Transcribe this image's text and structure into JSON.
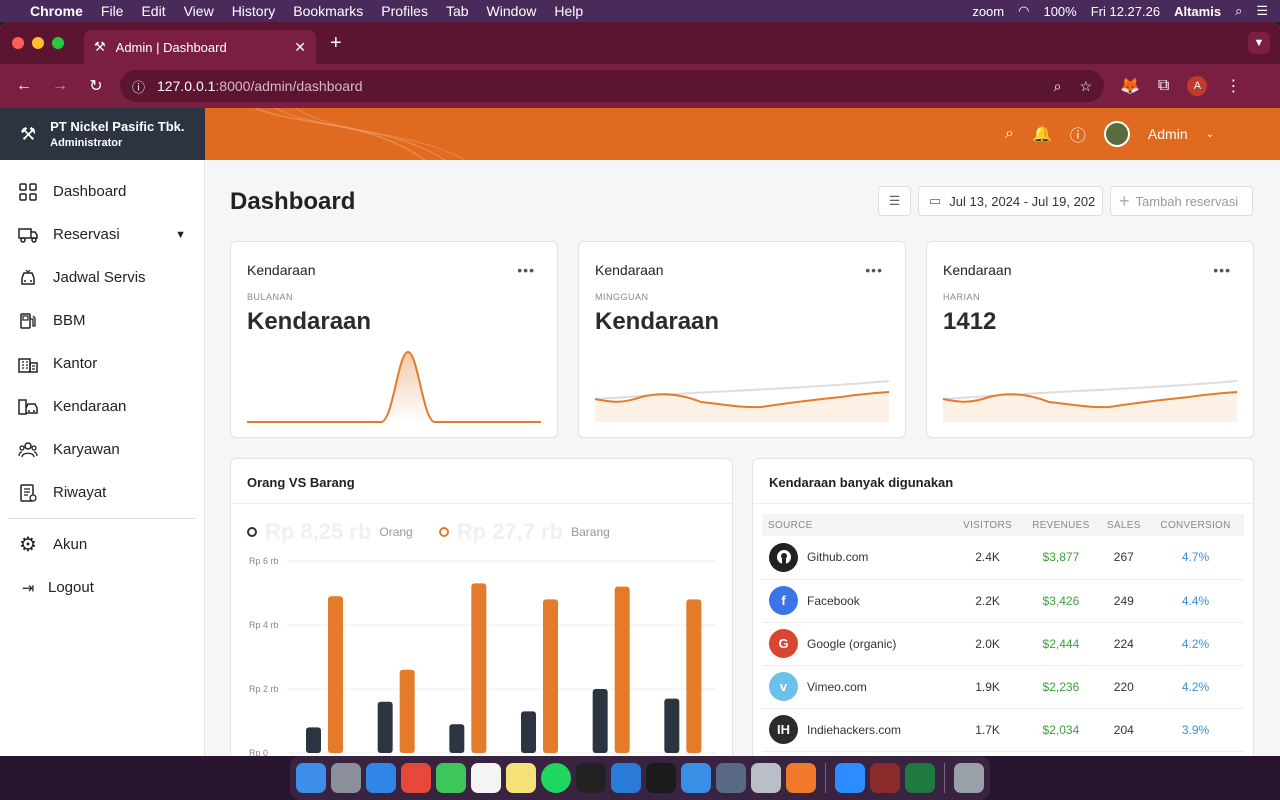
{
  "menubar": {
    "app": "Chrome",
    "items": [
      "File",
      "Edit",
      "View",
      "History",
      "Bookmarks",
      "Profiles",
      "Tab",
      "Window",
      "Help"
    ],
    "zoom": "zoom",
    "battery": "100%",
    "datetime": "Fri 12.27.26",
    "user": "Altamis"
  },
  "browser": {
    "tab_title": "Admin | Dashboard",
    "url_host": "127.0.0.1",
    "url_path": ":8000/admin/dashboard",
    "profile_initial": "A"
  },
  "brand": {
    "company": "PT Nickel Pasific Tbk.",
    "role": "Administrator"
  },
  "topbar": {
    "user_name": "Admin"
  },
  "sidebar": {
    "items": [
      {
        "label": "Dashboard",
        "icon": "grid-icon"
      },
      {
        "label": "Reservasi",
        "icon": "truck-icon"
      },
      {
        "label": "Jadwal Servis",
        "icon": "car-service-icon"
      },
      {
        "label": "BBM",
        "icon": "fuel-icon"
      },
      {
        "label": "Kantor",
        "icon": "building-icon"
      },
      {
        "label": "Kendaraan",
        "icon": "vehicle-icon"
      },
      {
        "label": "Karyawan",
        "icon": "people-icon"
      },
      {
        "label": "Riwayat",
        "icon": "history-icon"
      }
    ],
    "bottom": [
      {
        "label": "Akun",
        "icon": "gear-icon"
      },
      {
        "label": "Logout",
        "icon": "logout-icon"
      }
    ]
  },
  "page": {
    "title": "Dashboard",
    "date_range": "Jul 13, 2024 - Jul 19, 202",
    "add_button": "Tambah reservasi"
  },
  "stat_cards": [
    {
      "title": "Kendaraan",
      "period": "BULANAN",
      "value": "Kendaraan"
    },
    {
      "title": "Kendaraan",
      "period": "MINGGUAN",
      "value": "Kendaraan"
    },
    {
      "title": "Kendaraan",
      "period": "HARIAN",
      "value": "1412"
    }
  ],
  "chart_card": {
    "title": "Orang VS Barang",
    "legend": [
      {
        "amount": "Rp 8,25 rb",
        "name": "Orang",
        "color": "#2b3440"
      },
      {
        "amount": "Rp 27,7 rb",
        "name": "Barang",
        "color": "#e37b2a"
      }
    ]
  },
  "chart_data": {
    "type": "bar",
    "categories": [
      "",
      "",
      "",
      "",
      "",
      ""
    ],
    "series": [
      {
        "name": "Orang",
        "color": "#2b3440",
        "values": [
          800,
          1600,
          900,
          1300,
          2000,
          1700
        ]
      },
      {
        "name": "Barang",
        "color": "#e37b2a",
        "values": [
          4900,
          2600,
          5300,
          4800,
          5200,
          4800
        ]
      }
    ],
    "yticks": [
      "Rp 0",
      "Rp 2 rb",
      "Rp 4 rb",
      "Rp 6 rb"
    ],
    "ylim": [
      0,
      6000
    ],
    "grid": true
  },
  "table_card": {
    "title": "Kendaraan banyak digunakan",
    "columns": [
      "SOURCE",
      "VISITORS",
      "REVENUES",
      "SALES",
      "CONVERSION"
    ],
    "rows": [
      {
        "source": "Github.com",
        "icon": "github-icon",
        "icon_text": "",
        "color": "#222222",
        "visitors": "2.4K",
        "revenues": "$3,877",
        "sales": "267",
        "conversion": "4.7%"
      },
      {
        "source": "Facebook",
        "icon": "facebook-icon",
        "icon_text": "f",
        "color": "#3b74e6",
        "visitors": "2.2K",
        "revenues": "$3,426",
        "sales": "249",
        "conversion": "4.4%"
      },
      {
        "source": "Google (organic)",
        "icon": "google-icon",
        "icon_text": "G",
        "color": "#d8462f",
        "visitors": "2.0K",
        "revenues": "$2,444",
        "sales": "224",
        "conversion": "4.2%"
      },
      {
        "source": "Vimeo.com",
        "icon": "vimeo-icon",
        "icon_text": "v",
        "color": "#6cc1ea",
        "visitors": "1.9K",
        "revenues": "$2,236",
        "sales": "220",
        "conversion": "4.2%"
      },
      {
        "source": "Indiehackers.com",
        "icon": "indiehackers-icon",
        "icon_text": "IH",
        "color": "#2b2b2b",
        "visitors": "1.7K",
        "revenues": "$2,034",
        "sales": "204",
        "conversion": "3.9%"
      }
    ]
  }
}
